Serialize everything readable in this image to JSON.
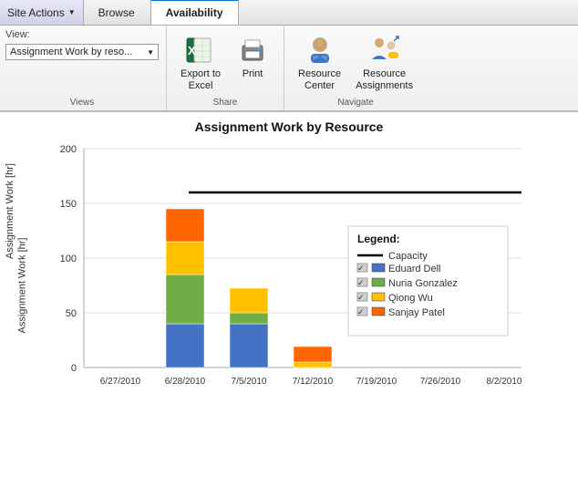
{
  "nav": {
    "site_actions_label": "Site Actions",
    "browse_tab": "Browse",
    "availability_tab": "Availability"
  },
  "ribbon": {
    "view_label": "View:",
    "view_dropdown_value": "Assignment Work by reso...",
    "views_group_label": "Views",
    "share_group_label": "Share",
    "navigate_group_label": "Navigate",
    "export_excel_label": "Export to\nExcel",
    "print_label": "Print",
    "resource_center_label": "Resource\nCenter",
    "resource_assignments_label": "Resource\nAssignments"
  },
  "chart": {
    "title": "Assignment Work by Resource",
    "y_label": "Assignment Work [hr]",
    "capacity_line_value": 160,
    "y_axis": [
      0,
      50,
      100,
      150,
      200
    ],
    "x_labels": [
      "6/27/2010",
      "6/28/2010",
      "7/5/2010",
      "7/12/2010",
      "7/19/2010",
      "7/26/2010",
      "8/2/2010"
    ],
    "bars": [
      {
        "x": "6/27/2010",
        "segments": []
      },
      {
        "x": "6/28/2010",
        "segments": [
          {
            "value": 40,
            "color": "#4472C4"
          },
          {
            "value": 45,
            "color": "#70AD47"
          },
          {
            "value": 30,
            "color": "#FFC000"
          },
          {
            "value": 30,
            "color": "#FF6600"
          }
        ]
      },
      {
        "x": "7/5/2010",
        "segments": [
          {
            "value": 40,
            "color": "#4472C4"
          },
          {
            "value": 10,
            "color": "#70AD47"
          },
          {
            "value": 22,
            "color": "#FFC000"
          }
        ]
      },
      {
        "x": "7/12/2010",
        "segments": [
          {
            "value": 5,
            "color": "#FFC000"
          },
          {
            "value": 12,
            "color": "#FF6600"
          }
        ]
      },
      {
        "x": "7/19/2010",
        "segments": []
      },
      {
        "x": "7/26/2010",
        "segments": []
      },
      {
        "x": "8/2/2010",
        "segments": []
      }
    ],
    "legend": {
      "title": "Legend:",
      "capacity_label": "Capacity",
      "items": [
        {
          "name": "Eduard Dell",
          "color": "#4472C4"
        },
        {
          "name": "Nuria Gonzalez",
          "color": "#70AD47"
        },
        {
          "name": "Qiong Wu",
          "color": "#FFC000"
        },
        {
          "name": "Sanjay Patel",
          "color": "#FF6600"
        }
      ]
    }
  }
}
